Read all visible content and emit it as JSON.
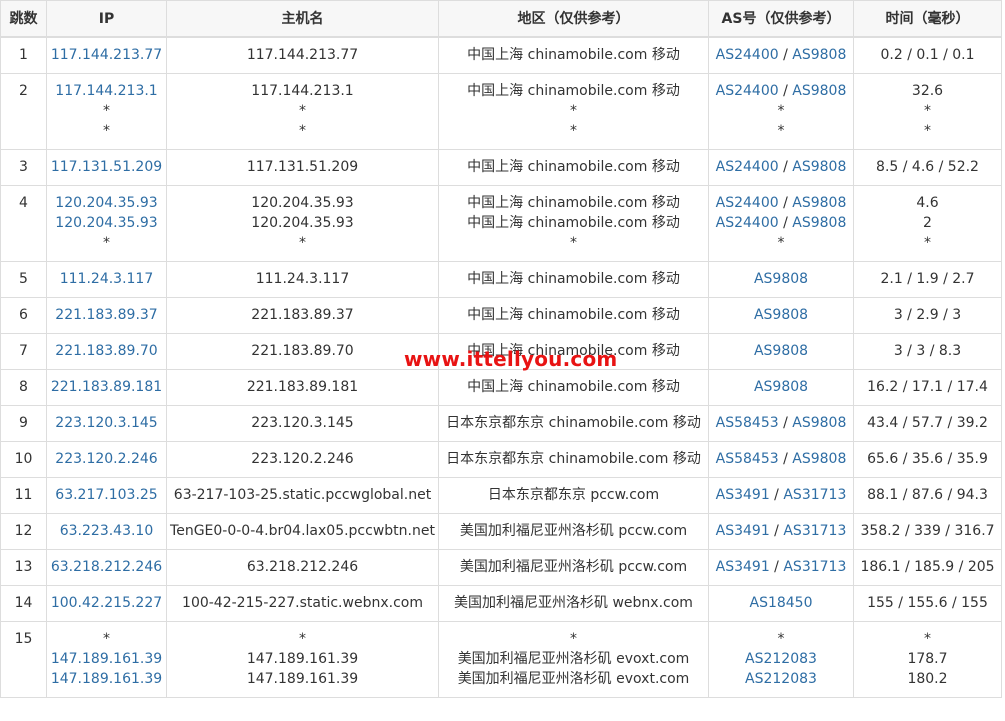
{
  "headers": {
    "hop": "跳数",
    "ip": "IP",
    "host": "主机名",
    "region": "地区（仅供参考）",
    "as": "AS号（仅供参考）",
    "time": "时间（毫秒）"
  },
  "watermark": "www.ittellyou.com",
  "rows": [
    {
      "hop": "1",
      "lines": [
        {
          "ip": "117.144.213.77",
          "host": "117.144.213.77",
          "region": "中国上海 chinamobile.com 移动",
          "as": [
            "AS24400",
            "AS9808"
          ],
          "time": "0.2 / 0.1 / 0.1"
        }
      ]
    },
    {
      "hop": "2",
      "lines": [
        {
          "ip": "117.144.213.1",
          "host": "117.144.213.1",
          "region": "中国上海 chinamobile.com 移动",
          "as": [
            "AS24400",
            "AS9808"
          ],
          "time": "32.6"
        },
        {
          "ip": "*",
          "host": "*",
          "region": "*",
          "as": [
            "*"
          ],
          "time": "*"
        },
        {
          "ip": "*",
          "host": "*",
          "region": "*",
          "as": [
            "*"
          ],
          "time": "*"
        }
      ]
    },
    {
      "hop": "3",
      "lines": [
        {
          "ip": "117.131.51.209",
          "host": "117.131.51.209",
          "region": "中国上海 chinamobile.com 移动",
          "as": [
            "AS24400",
            "AS9808"
          ],
          "time": "8.5 / 4.6 / 52.2"
        }
      ]
    },
    {
      "hop": "4",
      "lines": [
        {
          "ip": "120.204.35.93",
          "host": "120.204.35.93",
          "region": "中国上海 chinamobile.com 移动",
          "as": [
            "AS24400",
            "AS9808"
          ],
          "time": "4.6"
        },
        {
          "ip": "120.204.35.93",
          "host": "120.204.35.93",
          "region": "中国上海 chinamobile.com 移动",
          "as": [
            "AS24400",
            "AS9808"
          ],
          "time": "2"
        },
        {
          "ip": "*",
          "host": "*",
          "region": "*",
          "as": [
            "*"
          ],
          "time": "*"
        }
      ]
    },
    {
      "hop": "5",
      "lines": [
        {
          "ip": "111.24.3.117",
          "host": "111.24.3.117",
          "region": "中国上海 chinamobile.com 移动",
          "as": [
            "AS9808"
          ],
          "time": "2.1 / 1.9 / 2.7"
        }
      ]
    },
    {
      "hop": "6",
      "lines": [
        {
          "ip": "221.183.89.37",
          "host": "221.183.89.37",
          "region": "中国上海 chinamobile.com 移动",
          "as": [
            "AS9808"
          ],
          "time": "3 / 2.9 / 3"
        }
      ]
    },
    {
      "hop": "7",
      "lines": [
        {
          "ip": "221.183.89.70",
          "host": "221.183.89.70",
          "region": "中国上海 chinamobile.com 移动",
          "as": [
            "AS9808"
          ],
          "time": "3 / 3 / 8.3"
        }
      ]
    },
    {
      "hop": "8",
      "lines": [
        {
          "ip": "221.183.89.181",
          "host": "221.183.89.181",
          "region": "中国上海 chinamobile.com 移动",
          "as": [
            "AS9808"
          ],
          "time": "16.2 / 17.1 / 17.4"
        }
      ]
    },
    {
      "hop": "9",
      "lines": [
        {
          "ip": "223.120.3.145",
          "host": "223.120.3.145",
          "region": "日本东京都东京 chinamobile.com 移动",
          "as": [
            "AS58453",
            "AS9808"
          ],
          "time": "43.4 / 57.7 / 39.2"
        }
      ]
    },
    {
      "hop": "10",
      "lines": [
        {
          "ip": "223.120.2.246",
          "host": "223.120.2.246",
          "region": "日本东京都东京 chinamobile.com 移动",
          "as": [
            "AS58453",
            "AS9808"
          ],
          "time": "65.6 / 35.6 / 35.9"
        }
      ]
    },
    {
      "hop": "11",
      "lines": [
        {
          "ip": "63.217.103.25",
          "host": "63-217-103-25.static.pccwglobal.net",
          "region": "日本东京都东京 pccw.com",
          "as": [
            "AS3491",
            "AS31713"
          ],
          "time": "88.1 / 87.6 / 94.3"
        }
      ]
    },
    {
      "hop": "12",
      "lines": [
        {
          "ip": "63.223.43.10",
          "host": "TenGE0-0-0-4.br04.lax05.pccwbtn.net",
          "region": "美国加利福尼亚州洛杉矶 pccw.com",
          "as": [
            "AS3491",
            "AS31713"
          ],
          "time": "358.2 / 339 / 316.7"
        }
      ]
    },
    {
      "hop": "13",
      "lines": [
        {
          "ip": "63.218.212.246",
          "host": "63.218.212.246",
          "region": "美国加利福尼亚州洛杉矶 pccw.com",
          "as": [
            "AS3491",
            "AS31713"
          ],
          "time": "186.1 / 185.9 / 205"
        }
      ]
    },
    {
      "hop": "14",
      "lines": [
        {
          "ip": "100.42.215.227",
          "host": "100-42-215-227.static.webnx.com",
          "region": "美国加利福尼亚州洛杉矶 webnx.com",
          "as": [
            "AS18450"
          ],
          "time": "155 / 155.6 / 155"
        }
      ]
    },
    {
      "hop": "15",
      "lines": [
        {
          "ip": "*",
          "host": "*",
          "region": "*",
          "as": [
            "*"
          ],
          "time": "*"
        },
        {
          "ip": "147.189.161.39",
          "host": "147.189.161.39",
          "region": "美国加利福尼亚州洛杉矶 evoxt.com",
          "as": [
            "AS212083"
          ],
          "time": "178.7"
        },
        {
          "ip": "147.189.161.39",
          "host": "147.189.161.39",
          "region": "美国加利福尼亚州洛杉矶 evoxt.com",
          "as": [
            "AS212083"
          ],
          "time": "180.2"
        }
      ]
    }
  ]
}
